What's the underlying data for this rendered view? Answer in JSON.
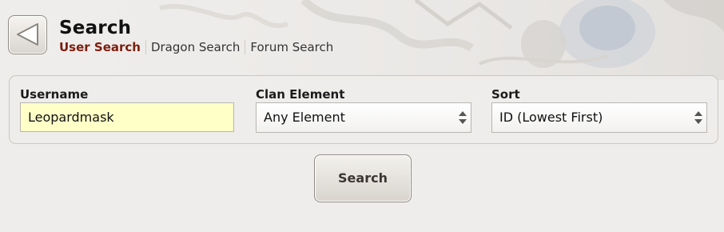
{
  "header": {
    "title": "Search",
    "tabs": [
      {
        "label": "User Search",
        "active": true
      },
      {
        "label": "Dragon Search",
        "active": false
      },
      {
        "label": "Forum Search",
        "active": false
      }
    ]
  },
  "form": {
    "username": {
      "label": "Username",
      "value": "Leopardmask"
    },
    "clan_element": {
      "label": "Clan Element",
      "selected": "Any Element"
    },
    "sort": {
      "label": "Sort",
      "selected": "ID (Lowest First)"
    }
  },
  "actions": {
    "search_label": "Search"
  },
  "colors": {
    "active_tab": "#7b1d0e",
    "input_bg": "#ffffc8",
    "page_bg": "#efedeb",
    "panel_border": "#cbc7c2"
  },
  "icons": {
    "back": "back-arrow-icon",
    "select_arrows": "updown-arrows-icon"
  }
}
